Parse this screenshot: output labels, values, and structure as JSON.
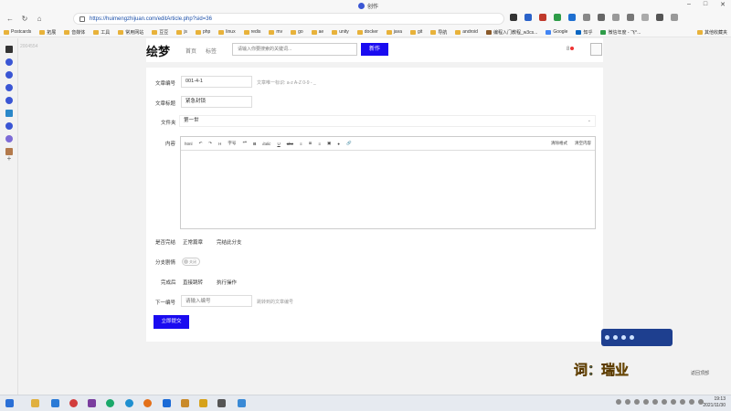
{
  "browser": {
    "tab_title": "创作",
    "url": "https://huimengzhijuan.com/editArticle.php?sid=36",
    "bookmarks": [
      "Postcards",
      "拓展",
      "音媒体",
      "工具",
      "常用网站",
      "豆豆",
      "js",
      "php",
      "linux",
      "redis",
      "mv",
      "go",
      "ae",
      "unity",
      "docker",
      "java",
      "git",
      "导航",
      "android",
      "编程入门教程_w3cs...",
      "Google",
      "知乎",
      "微信年度 - 飞^..."
    ],
    "bookmark_right": "其他收藏夹",
    "sidebar_label": "2004554"
  },
  "header": {
    "logo": "绘梦",
    "nav_home": "首页",
    "nav_tag": "标签",
    "search_placeholder": "请输入你要搜索的关键词...",
    "new_button": "新作",
    "bell": "8"
  },
  "form": {
    "article_id_label": "文章编号",
    "article_id_value": "001-4-1",
    "article_id_hint": "文章唯一标识: a-z A-Z 0-9 - _",
    "article_title_label": "文章标题",
    "article_title_value": "紧急封锁",
    "folder_label": "文件夹",
    "folder_value": "第一世",
    "content_label": "内容",
    "editor_toolbar": [
      "html",
      "↶",
      "↷",
      "H",
      "字号",
      "❝❞",
      "B",
      "italic",
      "U",
      "abc",
      "≡",
      "≣",
      "≡",
      "▣",
      "●",
      "🔗"
    ],
    "editor_right": [
      "清除格式",
      "清空内容"
    ],
    "is_end_label": "是否完结",
    "is_end_options": [
      "正常篇章",
      "完结此分支"
    ],
    "branch_label": "分支剧情",
    "branch_switch": "关闭",
    "after_end_label": "完成后",
    "after_end_options": [
      "直接跳转",
      "执行操作"
    ],
    "next_id_label": "下一编号",
    "next_id_placeholder": "请输入编号",
    "next_id_hint": "跳转到的文章编号",
    "submit_button": "立即提交"
  },
  "overlay": {
    "caption_prefix": "词",
    "caption_colon": "：",
    "caption_name": "瑞业",
    "back_top": "返回顶部"
  },
  "taskbar": {
    "time": "19:13",
    "date": "2021/11/30"
  }
}
